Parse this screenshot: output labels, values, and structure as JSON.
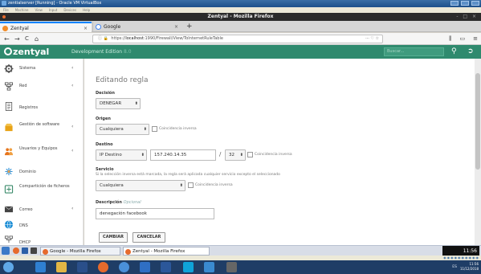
{
  "vbox": {
    "title": "zentialserver [Running] - Oracle VM VirtualBox",
    "menu": [
      "File",
      "Machine",
      "View",
      "Input",
      "Devices",
      "Help"
    ]
  },
  "firefox": {
    "window_title": "Zentyal - Mozilla Firefox",
    "window_controls": "- □ ×",
    "tabs": [
      {
        "label": "Zentyal",
        "close": "×"
      },
      {
        "label": "Google",
        "close": "×"
      }
    ],
    "new_tab": "+",
    "nav": {
      "back": "←",
      "forward": "→",
      "reload": "C",
      "home": "⌂"
    },
    "url_prefix": "https://",
    "url_domain": "localhost",
    "url_rest": ":1990/Firewall/View/ToInternetRuleTable",
    "url_actions": "··· ♡ ☆",
    "toolbar_right": [
      "⫼",
      "▭",
      "≡"
    ]
  },
  "zentyal": {
    "logo": "zentyal",
    "edition": "Development Edition",
    "edition_version": "8.0",
    "search_placeholder": "Buscar..."
  },
  "sidebar": [
    {
      "label": "Sistema",
      "icon": "gear-icon",
      "color": "#555555",
      "arrow": true
    },
    {
      "label": "Red",
      "icon": "network-icon",
      "color": "#555555",
      "arrow": true
    },
    {
      "label": "Registros",
      "icon": "logs-icon",
      "color": "#666666",
      "arrow": false
    },
    {
      "label": "Gestión de software",
      "icon": "software-icon",
      "color": "#e8a317",
      "arrow": true
    },
    {
      "label": "Usuarios y Equipos",
      "icon": "users-icon",
      "color": "#e6741d",
      "arrow": true
    },
    {
      "label": "Dominio",
      "icon": "domain-icon",
      "color": "#2d8fd5",
      "arrow": false
    },
    {
      "label": "Compartición de ficheros",
      "icon": "share-icon",
      "color": "#3a8a6a",
      "arrow": false
    },
    {
      "label": "Correo",
      "icon": "mail-icon",
      "color": "#444444",
      "arrow": true
    },
    {
      "label": "DNS",
      "icon": "dns-icon",
      "color": "#1f8fd6",
      "arrow": false
    },
    {
      "label": "DHCP",
      "icon": "dhcp-icon",
      "color": "#666666",
      "arrow": false
    }
  ],
  "form": {
    "title": "Editando regla",
    "decision_label": "Decisión",
    "decision_value": "DENEGAR",
    "origen_label": "Origen",
    "origen_value": "Cualquiera",
    "origen_inverse": "Coincidencia inversa",
    "destino_label": "Destino",
    "destino_type": "IP Destino",
    "destino_ip": "157.240.14.35",
    "destino_slash": "/",
    "destino_mask": "32",
    "destino_inverse": "Coincidencia inversa",
    "servicio_label": "Servicio",
    "servicio_hint": "Si la selección inversa está marcada, la regla será aplicada cualquier servicio excepto el seleccionado",
    "servicio_value": "Cualquiera",
    "servicio_inverse": "Coincidencia inversa",
    "descripcion_label": "Descripción",
    "descripcion_optional": "Opcional",
    "descripcion_value": "denegación facebook",
    "change_button": "CAMBIAR",
    "cancel_button": "CANCELAR"
  },
  "guest_taskbar": {
    "tasks": [
      "Google - Mozilla Firefox",
      "Zentyal - Mozilla Firefox"
    ],
    "clock": "11:56"
  },
  "host_taskbar": {
    "system_text": "ES",
    "time": "11:56",
    "date": "11/12/2018"
  }
}
